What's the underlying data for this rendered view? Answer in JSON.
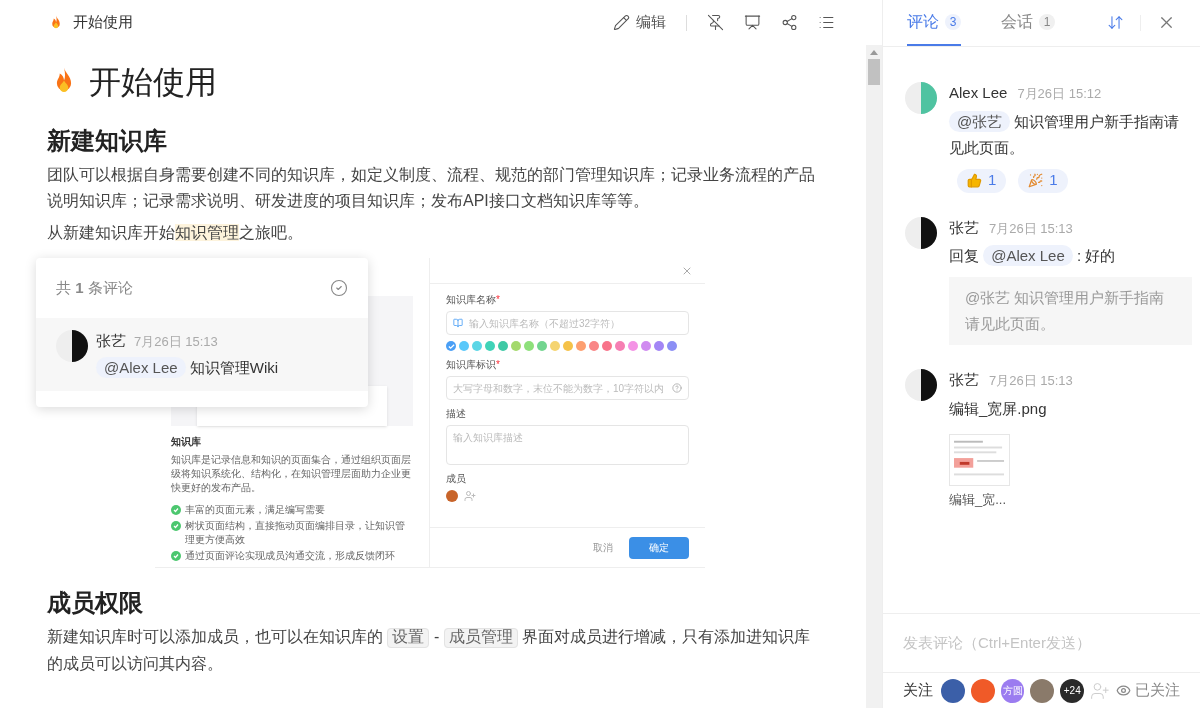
{
  "doc": {
    "title": "开始使用",
    "toolbar": {
      "edit": "编辑"
    },
    "heading": "开始使用",
    "blocks": [
      {
        "kind": "h2",
        "text": "新建知识库"
      },
      {
        "kind": "paragraph",
        "parts": [
          {
            "kind": "text",
            "text": "团队可以根据自身需要创建不同的知识库，如定义制度、流程、规范的部门管理知识库；记录业务流程的产品说明知识库；记录需求说明、研发进度的项目知识库；发布API接口文档知识库等等。"
          }
        ]
      },
      {
        "kind": "paragraph",
        "parts": [
          {
            "kind": "text",
            "text": "从新建知识库开始"
          },
          {
            "kind": "highlight",
            "text": "知识管理"
          },
          {
            "kind": "text",
            "text": "之旅吧。"
          }
        ]
      },
      {
        "kind": "figure"
      },
      {
        "kind": "h2",
        "text": "成员权限"
      },
      {
        "kind": "paragraph",
        "parts": [
          {
            "kind": "text",
            "text": "新建知识库时可以添加成员，也可以在知识库的 "
          },
          {
            "kind": "code",
            "text": "设置"
          },
          {
            "kind": "text",
            "text": " - "
          },
          {
            "kind": "code",
            "text": "成员管理"
          },
          {
            "kind": "text",
            "text": " 界面对成员进行增减，只有添加进知识库的成员可以访问其内容。"
          }
        ]
      }
    ]
  },
  "figure": {
    "left": {
      "heading": "知识库",
      "description": "知识库是记录信息和知识的页面集合，通过组织页面层级将知识系统化、结构化，在知识管理层面助力企业更快更好的发布产品。",
      "features": [
        "丰富的页面元素，满足编写需要",
        "树状页面结构，直接拖动页面编排目录，让知识管理更方便高效",
        "通过页面评论实现成员沟通交流，形成反馈闭环"
      ]
    },
    "right": {
      "fields": [
        {
          "kind": "icon-input",
          "label": "知识库名称",
          "required_mark": "*",
          "placeholder": "输入知识库名称（不超过32字符）"
        },
        {
          "kind": "swatches",
          "colors": [
            {
              "color": "#4a9ff5",
              "selected": true
            },
            {
              "color": "#5ac8fa",
              "selected": false
            },
            {
              "color": "#5bd6e6",
              "selected": false
            },
            {
              "color": "#40d3b8",
              "selected": false
            },
            {
              "color": "#3fc9a5",
              "selected": false
            },
            {
              "color": "#a4d96c",
              "selected": false
            },
            {
              "color": "#8ee07b",
              "selected": false
            },
            {
              "color": "#72d58f",
              "selected": false
            },
            {
              "color": "#f5d470",
              "selected": false
            },
            {
              "color": "#f5c249",
              "selected": false
            },
            {
              "color": "#fd9f70",
              "selected": false
            },
            {
              "color": "#f98686",
              "selected": false
            },
            {
              "color": "#f8738a",
              "selected": false
            },
            {
              "color": "#f67fb3",
              "selected": false
            },
            {
              "color": "#f493e5",
              "selected": false
            },
            {
              "color": "#d08bf0",
              "selected": false
            },
            {
              "color": "#a386f5",
              "selected": false
            },
            {
              "color": "#8c8ff5",
              "selected": false
            }
          ]
        },
        {
          "kind": "help-input",
          "label": "知识库标识",
          "required_mark": "*",
          "placeholder": "大写字母和数字，末位不能为数字，10字符以内"
        },
        {
          "kind": "textarea",
          "label": "描述",
          "placeholder": "输入知识库描述"
        },
        {
          "kind": "members",
          "label": "成员"
        }
      ],
      "cancel": "取消",
      "confirm": "确定"
    }
  },
  "popup": {
    "title": "共 **1** 条评论",
    "comment": {
      "author": "张艺",
      "time": "7月26日 15:13",
      "mention": "@Alex Lee",
      "text": "知识管理Wiki"
    }
  },
  "panel": {
    "tabs": [
      {
        "label": "评论",
        "count": "3",
        "selected": true
      },
      {
        "label": "会话",
        "count": "1",
        "selected": false
      }
    ],
    "comments": [
      {
        "author": "Alex Lee",
        "time": "7月26日 15:12",
        "body": [
          {
            "kind": "mention",
            "text": "@张艺"
          },
          {
            "kind": "text",
            "text": " 知识管理用户新手指南请见此页面。"
          }
        ],
        "reactions": [
          {
            "kind": "thumb",
            "count": "1"
          },
          {
            "kind": "party",
            "count": "1"
          }
        ]
      },
      {
        "author": "张艺",
        "time": "7月26日 15:13",
        "body": [
          {
            "kind": "text",
            "text": "回复 "
          },
          {
            "kind": "mention",
            "text": "@Alex Lee"
          },
          {
            "kind": "text",
            "text": " : 好的"
          }
        ],
        "quote": "@张艺 知识管理用户新手指南请见此页面。"
      },
      {
        "author": "张艺",
        "time": "7月26日 15:13",
        "body": [
          {
            "kind": "text",
            "text": "编辑_宽屏.png"
          }
        ],
        "attachment": {
          "name": "编辑_宽..."
        }
      }
    ],
    "composer": {
      "placeholder": "发表评论（Ctrl+Enter发送）"
    },
    "footer": {
      "label": "关注",
      "followers": [
        {
          "kind": "avatar",
          "color": "#3b5fa8"
        },
        {
          "kind": "avatar",
          "color": "#f05a28"
        },
        {
          "kind": "text",
          "text": "方圆",
          "color": "#9b7cf0"
        },
        {
          "kind": "avatar",
          "color": "#8a7a6a"
        },
        {
          "kind": "more",
          "text": "+24",
          "color": "#2a2a2a"
        }
      ],
      "follow": "已关注"
    }
  }
}
